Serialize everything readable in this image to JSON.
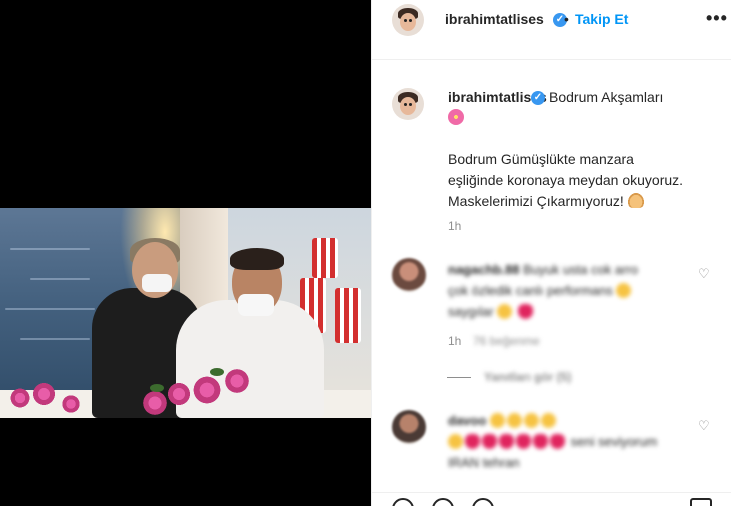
{
  "post": {
    "username": "ibrahimtatlises",
    "follow_label": "Takip Et",
    "separator": "•",
    "more_label": "•••",
    "caption_title": "Bodrum Akşamları",
    "caption_lines": [
      "Bodrum Gümüşlükte manzara",
      "eşliğinde koronaya meydan okuyoruz.",
      "Maskelerimizi Çıkarmıyoruz!"
    ],
    "caption_time": "1h"
  },
  "comments": [
    {
      "username": "nagachb.88",
      "text_line1": "Buyuk usta cok arro",
      "text_line2": "çok özledik canlı performans",
      "text_line3": "saygılar",
      "time": "1h",
      "likes": "76 beğenme",
      "replies": "Yanıtları gör (5)"
    },
    {
      "username": "davoo",
      "text_line1": "",
      "text_line2": "seni seviyorum",
      "text_line3": "IRAN tehran"
    }
  ],
  "icons": {
    "verified": "verified-badge-icon",
    "more": "more-options-icon",
    "heart": "heart-outline-icon",
    "flower": "hibiscus-emoji-icon",
    "pray": "folded-hands-emoji-icon"
  },
  "colors": {
    "accent": "#0095f6",
    "verified": "#3897f0",
    "secondary_text": "#8e8e8e"
  }
}
